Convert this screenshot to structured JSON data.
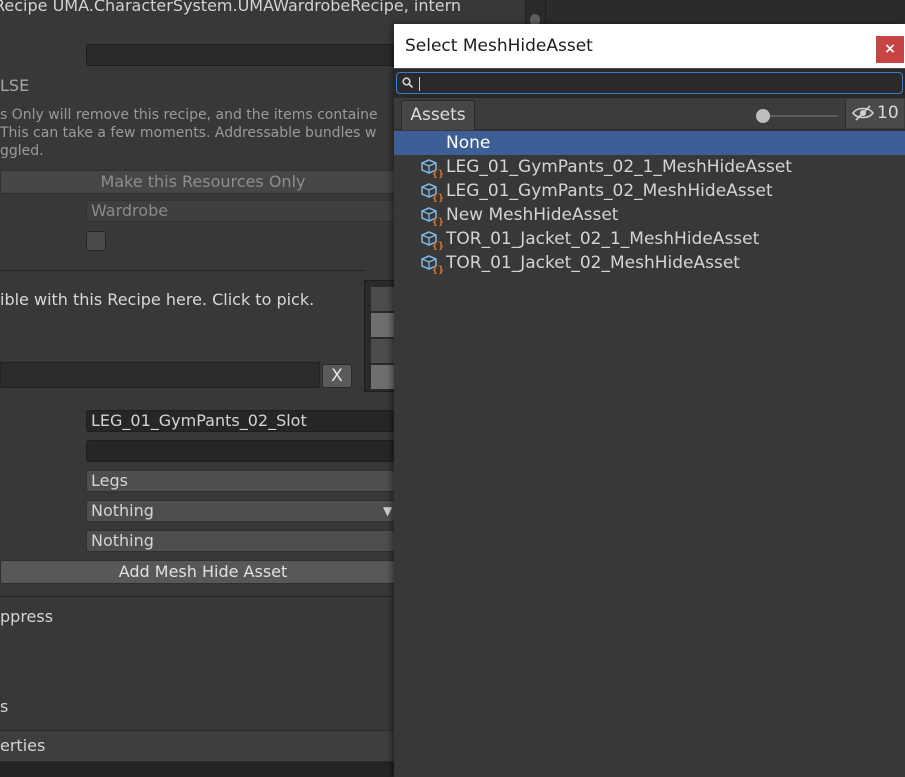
{
  "inspector": {
    "title": "Recipe UMA.CharacterSystem.UMAWardrobeRecipe, intern",
    "false_label": "LSE",
    "info_lines": [
      "s Only will remove this recipe, and the items containe",
      "This can take a few moments. Addressable bundles w",
      "ggled."
    ],
    "make_resources_button": "Make this Resources Only",
    "wardrobe_field": "Wardrobe",
    "compatible_text": "ible with this Recipe here. Click to pick.",
    "clear_button": "X",
    "slot_field": "LEG_01_GymPants_02_Slot",
    "legs_field": "Legs",
    "nothing_dropdown": "Nothing",
    "nothing_field": "Nothing",
    "add_mesh_hide_button": "Add Mesh Hide Asset",
    "suppress_label": "ppress",
    "s_label": "s",
    "properties_label": "erties"
  },
  "picker": {
    "title": "Select MeshHideAsset",
    "close_label": "×",
    "search": {
      "value": "",
      "placeholder": ""
    },
    "tab_label": "Assets",
    "zoom_slider": 0,
    "hidden_count": "10",
    "items": [
      {
        "label": "None",
        "selected": true,
        "icon": ""
      },
      {
        "label": "LEG_01_GymPants_02_1_MeshHideAsset",
        "selected": false,
        "icon": "scriptable-object-icon"
      },
      {
        "label": "LEG_01_GymPants_02_MeshHideAsset",
        "selected": false,
        "icon": "scriptable-object-icon"
      },
      {
        "label": "New MeshHideAsset",
        "selected": false,
        "icon": "scriptable-object-icon"
      },
      {
        "label": "TOR_01_Jacket_02_1_MeshHideAsset",
        "selected": false,
        "icon": "scriptable-object-icon"
      },
      {
        "label": "TOR_01_Jacket_02_MeshHideAsset",
        "selected": false,
        "icon": "scriptable-object-icon"
      }
    ],
    "colors": {
      "selection": "#3e5f96",
      "close": "#c64444",
      "icon_cube": "#7fb8e6",
      "icon_braces": "#e07a2e"
    }
  }
}
